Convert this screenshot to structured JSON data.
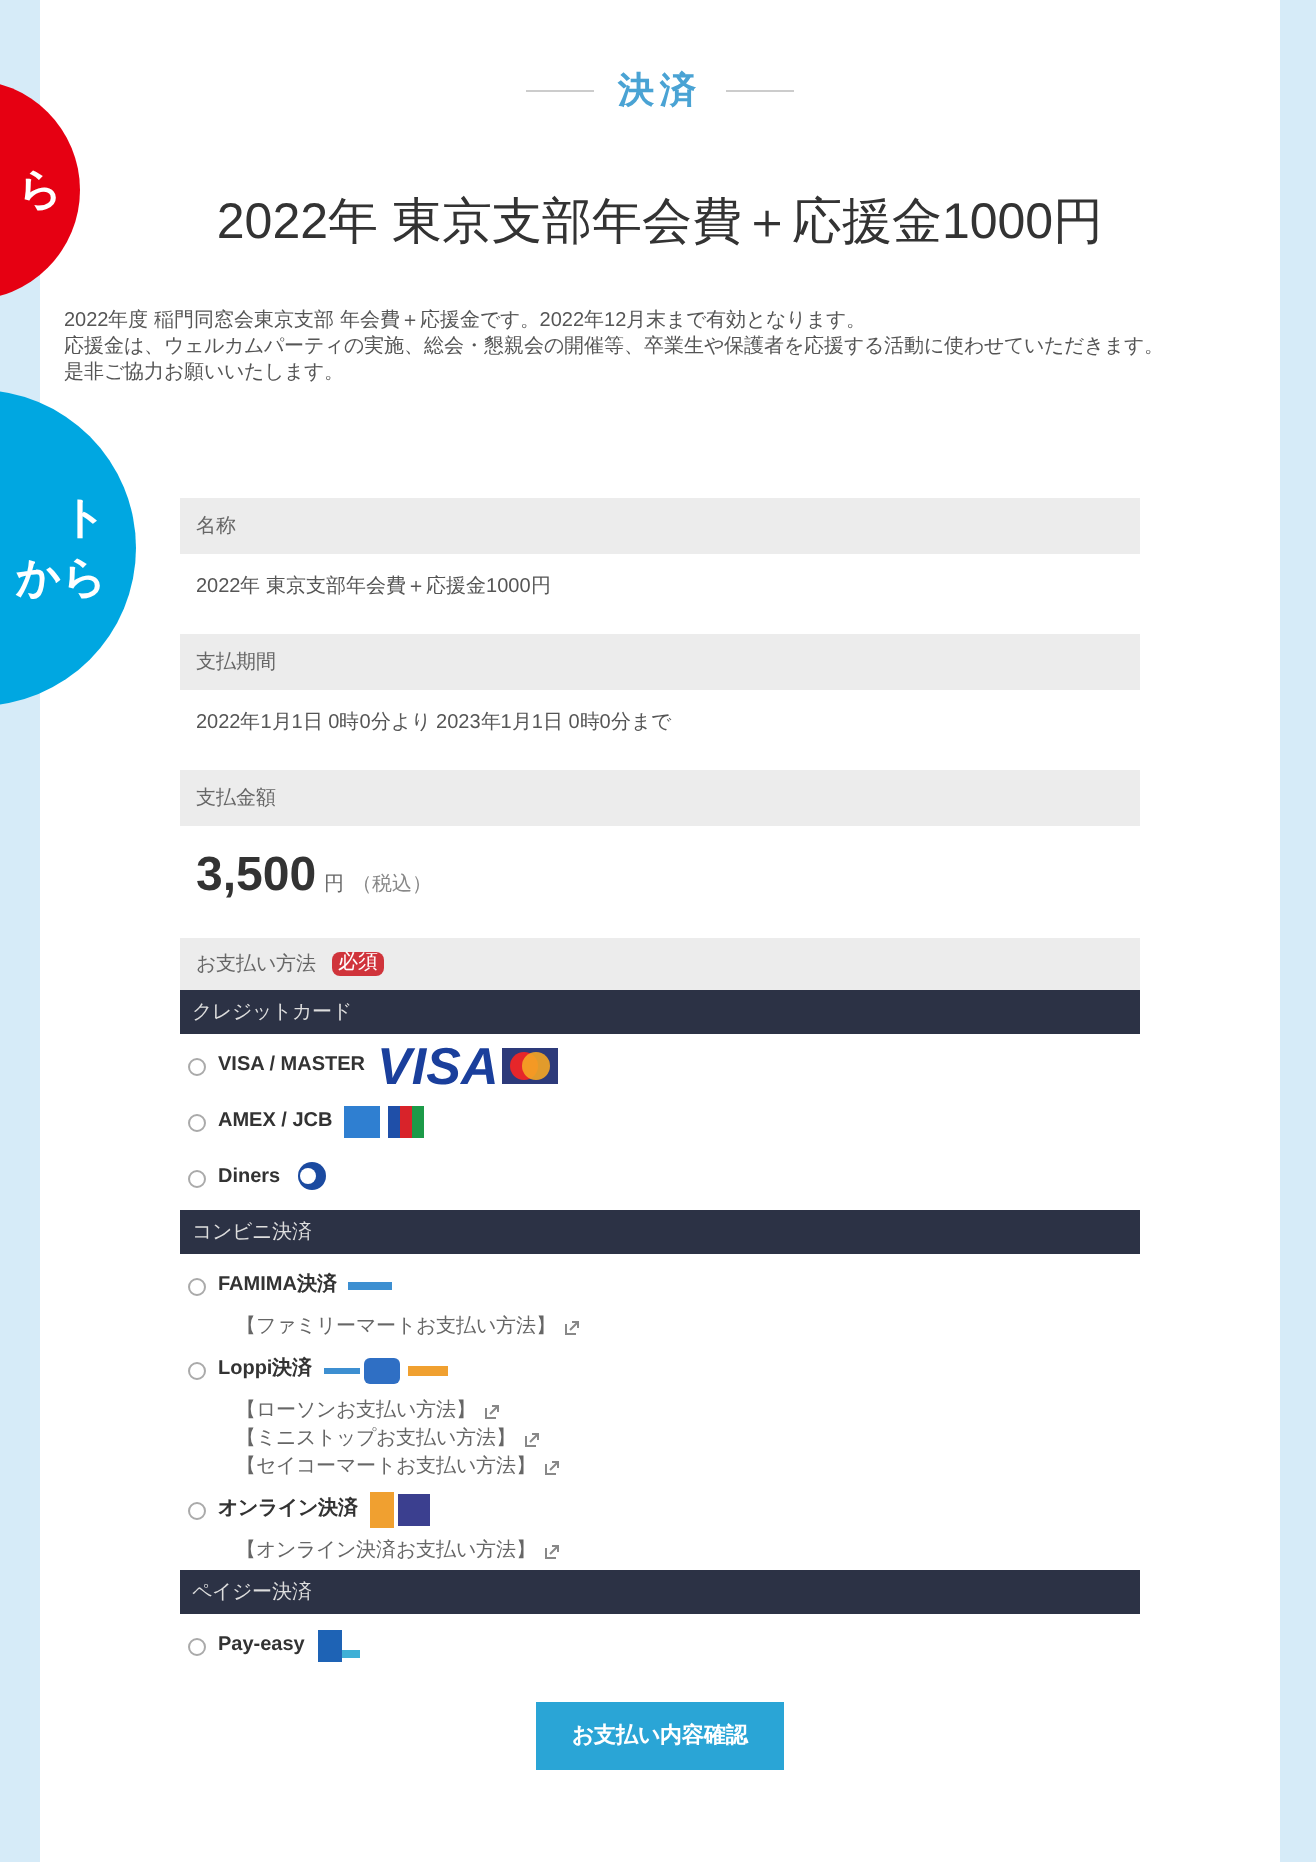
{
  "overlays": [
    {
      "kind": "red",
      "lines": [
        "ら"
      ]
    },
    {
      "kind": "blue",
      "lines": [
        "ト",
        "から"
      ]
    }
  ],
  "section_heading": "決済",
  "title": "2022年 東京支部年会費＋応援金1000円",
  "description": [
    "2022年度 稲門同窓会東京支部 年会費＋応援金です。2022年12月末まで有効となります。",
    "応援金は、ウェルカムパーティの実施、総会・懇親会の開催等、卒業生や保護者を応援する活動に使わせていただきます。",
    "是非ご協力お願いいたします。"
  ],
  "fields": [
    {
      "label": "名称",
      "value": "2022年 東京支部年会費＋応援金1000円"
    },
    {
      "label": "支払期間",
      "value": "2022年1月1日 0時0分より 2023年1月1日 0時0分まで"
    }
  ],
  "amount": {
    "label": "支払金額",
    "value": "3,500",
    "unit": "円",
    "note": "（税込）"
  },
  "payment": {
    "label": "お支払い方法",
    "required": "必須",
    "groups": [
      {
        "title": "クレジットカード",
        "options": [
          {
            "label": "VISA / MASTER",
            "selected": false,
            "kind": "visa",
            "logo_text": "VISA"
          },
          {
            "label": "AMEX / JCB",
            "selected": false,
            "kind": "amex"
          },
          {
            "label": "Diners",
            "selected": false,
            "kind": "diners"
          }
        ]
      },
      {
        "title": "コンビニ決済",
        "options": [
          {
            "label": "FAMIMA決済",
            "selected": false,
            "kind": "famima",
            "links": [
              "【ファミリーマートお支払い方法】"
            ]
          },
          {
            "label": "Loppi決済",
            "selected": false,
            "kind": "loppi",
            "links": [
              "【ローソンお支払い方法】",
              "【ミニストップお支払い方法】",
              "【セイコーマートお支払い方法】"
            ]
          },
          {
            "label": "オンライン決済",
            "selected": false,
            "kind": "online",
            "links": [
              "【オンライン決済お支払い方法】"
            ]
          }
        ]
      },
      {
        "title": "ペイジー決済",
        "options": [
          {
            "label": "Pay-easy",
            "selected": false,
            "kind": "payeasy"
          }
        ]
      }
    ]
  },
  "submit": "お支払い内容確認"
}
